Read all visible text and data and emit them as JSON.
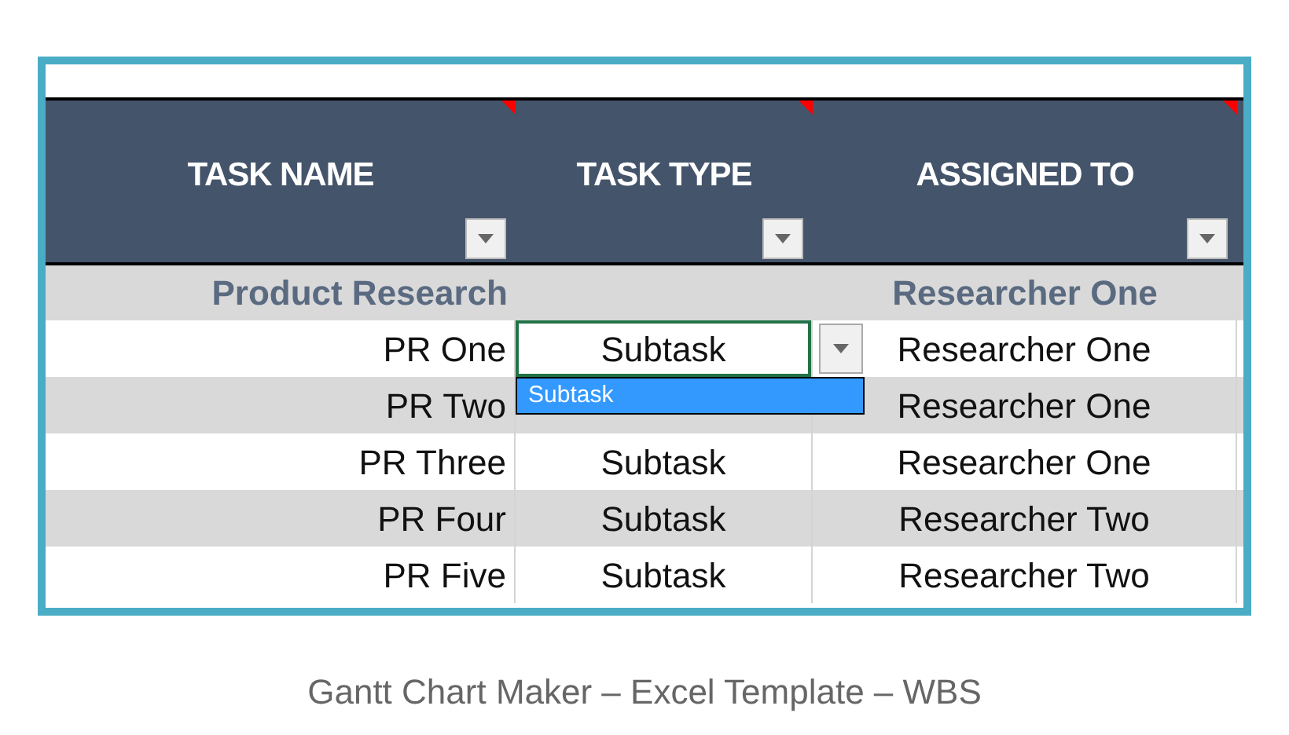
{
  "table": {
    "columns": [
      {
        "label": "TASK NAME",
        "has_comment": true
      },
      {
        "label": "TASK TYPE",
        "has_comment": true
      },
      {
        "label": "ASSIGNED TO",
        "has_comment": true
      }
    ],
    "rows": [
      {
        "kind": "group",
        "name": "Product Research",
        "assigned": "Researcher One"
      },
      {
        "kind": "task",
        "name": "PR One",
        "type": "Subtask",
        "assigned": "Researcher One",
        "selected": true
      },
      {
        "kind": "task",
        "name": "PR Two",
        "assigned": "Researcher One",
        "selected": false
      },
      {
        "kind": "task",
        "name": "PR Three",
        "type": "Subtask",
        "assigned": "Researcher One",
        "selected": false
      },
      {
        "kind": "task",
        "name": "PR Four",
        "type": "Subtask",
        "assigned": "Researcher Two",
        "selected": false
      },
      {
        "kind": "task",
        "name": "PR Five",
        "type": "Subtask",
        "assigned": "Researcher Two",
        "selected": false
      }
    ],
    "dropdown": {
      "options": [
        {
          "label": "Subtask",
          "selected": true
        }
      ]
    }
  },
  "caption": "Gantt Chart Maker – Excel Template – WBS"
}
